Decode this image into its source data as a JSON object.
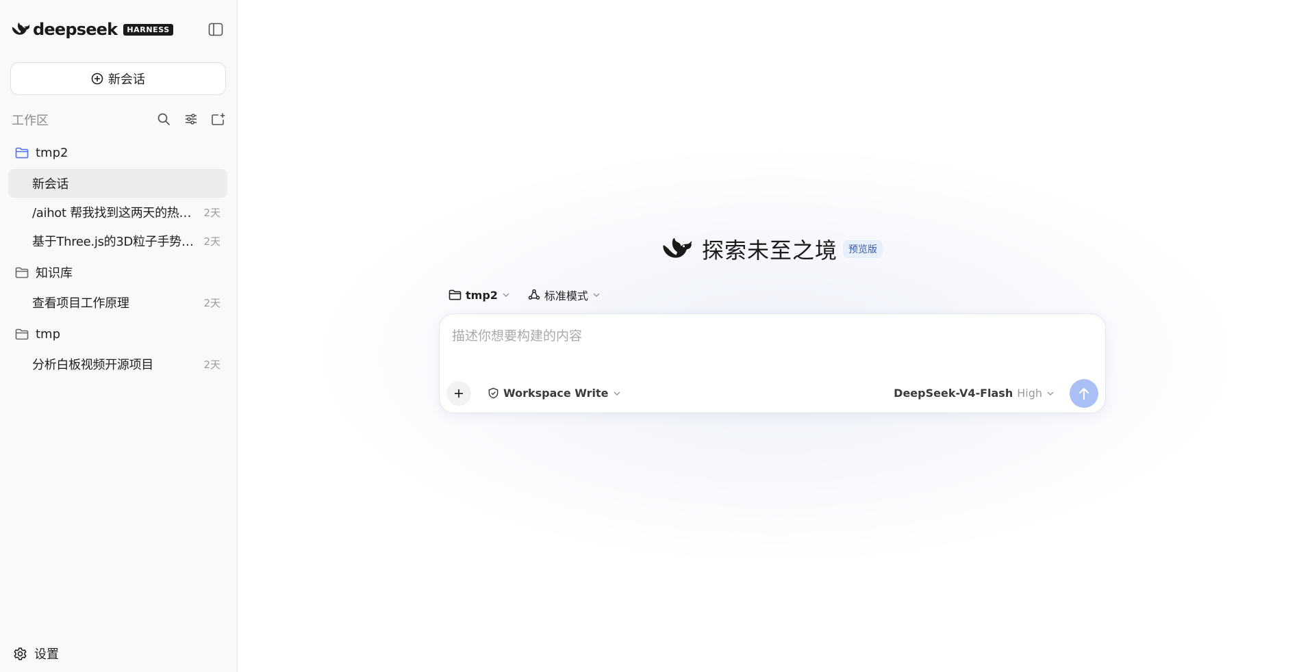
{
  "brand": {
    "name": "deepseek",
    "badge": "HARNESS"
  },
  "sidebar": {
    "new_chat_label": "新会话",
    "workspace_label": "工作区",
    "folders": [
      {
        "name": "tmp2",
        "conversations": [
          {
            "title": "新会话",
            "time": "",
            "active": true
          },
          {
            "title": "/aihot 帮我找到这两天的热点话",
            "time": "2天"
          },
          {
            "title": "基于Three.js的3D粒子手势控...",
            "time": "2天"
          }
        ]
      },
      {
        "name": "知识库",
        "conversations": [
          {
            "title": "查看项目工作原理",
            "time": "2天"
          }
        ]
      },
      {
        "name": "tmp",
        "conversations": [
          {
            "title": "分析白板视频开源项目",
            "time": "2天"
          }
        ]
      }
    ],
    "settings_label": "设置"
  },
  "main": {
    "hero_title": "探索未至之境",
    "preview_badge": "预览版",
    "context": {
      "folder": "tmp2",
      "mode": "标准模式"
    },
    "composer": {
      "placeholder": "描述你想要构建的内容",
      "permission": "Workspace Write",
      "model_name": "DeepSeek-V4-Flash",
      "model_level": "High"
    }
  },
  "colors": {
    "accent": "#4d6bfe",
    "send_button": "#a9bff5",
    "folder_active": "#4d6bfe"
  },
  "icons": [
    "whale-logo-icon",
    "sidebar-toggle-icon",
    "plus-circle-icon",
    "search-icon",
    "sliders-icon",
    "new-folder-icon",
    "folder-icon",
    "gear-icon",
    "plus-icon",
    "shield-icon",
    "chevron-down-icon",
    "mode-icon",
    "arrow-up-icon"
  ]
}
